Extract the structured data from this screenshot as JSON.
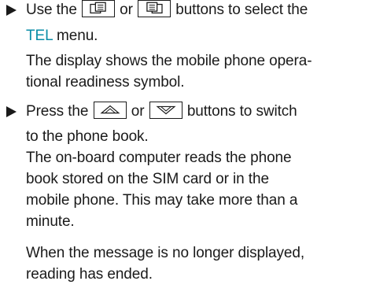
{
  "colors": {
    "accent": "#0a8ea8",
    "text": "#1a1a1a"
  },
  "steps": [
    {
      "lead_part1": "Use the",
      "lead_or": "or",
      "lead_part2": "buttons to select the",
      "buttons": [
        "menu-back-icon",
        "menu-forward-icon"
      ],
      "menu_name": "TEL",
      "menu_suffix": "menu.",
      "result_line1": "The display shows the mobile phone opera-",
      "result_line2": "tional readiness symbol."
    },
    {
      "lead_part1": "Press the",
      "lead_or": "or",
      "lead_part2": "buttons to switch",
      "buttons": [
        "up-arrow-icon",
        "down-arrow-icon"
      ],
      "lead_line2": "to the phone book.",
      "result_line1": "The on-board computer reads the phone",
      "result_line2": "book stored on the SIM card or in the",
      "result_line3": "mobile phone. This may take more than a",
      "result_line4": "minute."
    }
  ],
  "note_line1": "When the message is no longer displayed,",
  "note_line2": "reading has ended."
}
